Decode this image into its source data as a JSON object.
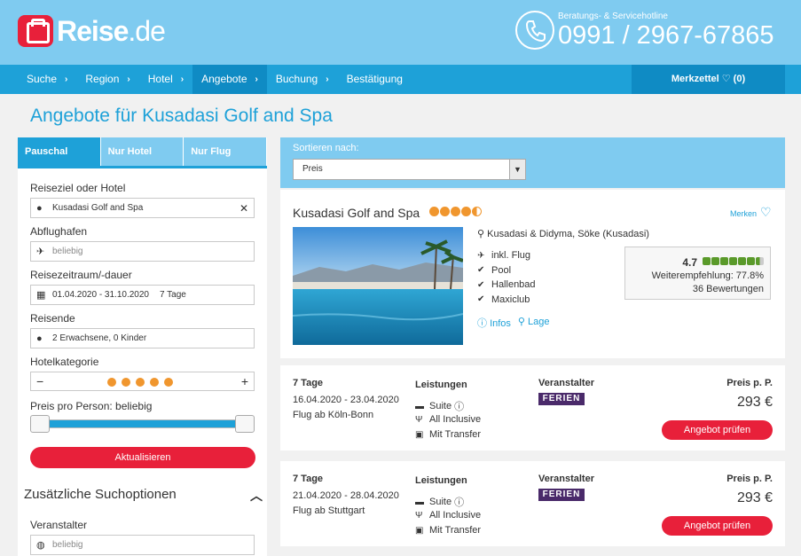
{
  "header": {
    "logo_main": "Reise",
    "logo_tld": ".de",
    "hotline_label": "Beratungs- & Servicehotline",
    "hotline_number": "0991 / 2967-67865"
  },
  "nav": {
    "items": [
      "Suche",
      "Region",
      "Hotel",
      "Angebote",
      "Buchung",
      "Bestätigung"
    ],
    "merkzettel": "Merkzettel ♡ (0)"
  },
  "page_title": "Angebote für Kusadasi Golf and Spa",
  "search": {
    "tabs": [
      "Pauschal",
      "Nur Hotel",
      "Nur Flug"
    ],
    "destination_label": "Reiseziel oder Hotel",
    "destination_value": "Kusadasi Golf and Spa",
    "airport_label": "Abflughafen",
    "airport_placeholder": "beliebig",
    "period_label": "Reisezeitraum/-dauer",
    "period_value": "01.04.2020 - 31.10.2020",
    "period_duration": "7 Tage",
    "travelers_label": "Reisende",
    "travelers_value": "2 Erwachsene, 0 Kinder",
    "category_label": "Hotelkategorie",
    "category_minus": "−",
    "category_plus": "+",
    "category_stars": 5,
    "price_label": "Preis pro Person: beliebig",
    "update_button": "Aktualisieren",
    "extra_title": "Zusätzliche Suchoptionen",
    "operator_label": "Veranstalter",
    "operator_placeholder": "beliebig"
  },
  "sort": {
    "label": "Sortieren nach:",
    "value": "Preis"
  },
  "hotel": {
    "name": "Kusadasi Golf and Spa",
    "stars": 4.5,
    "merken": "Merken",
    "location": "Kusadasi & Didyma, Söke (Kusadasi)",
    "features": [
      "inkl. Flug",
      "Pool",
      "Hallenbad",
      "Maxiclub"
    ],
    "links": [
      "Infos",
      "Lage"
    ],
    "review_score": "4.7",
    "review_recommend": "Weiterempfehlung: 77.8%",
    "review_count": "36 Bewertungen"
  },
  "offers": [
    {
      "duration": "7 Tage",
      "dates": "16.04.2020 - 23.04.2020",
      "flight": "Flug ab Köln-Bonn",
      "services_label": "Leistungen",
      "services": [
        "Suite",
        "All Inclusive",
        "Mit Transfer"
      ],
      "operator_label": "Veranstalter",
      "operator": "FERIEN",
      "price_label": "Preis p. P.",
      "price": "293 €",
      "button": "Angebot prüfen"
    },
    {
      "duration": "7 Tage",
      "dates": "21.04.2020 - 28.04.2020",
      "flight": "Flug ab Stuttgart",
      "services_label": "Leistungen",
      "services": [
        "Suite",
        "All Inclusive",
        "Mit Transfer"
      ],
      "operator_label": "Veranstalter",
      "operator": "FERIEN",
      "price_label": "Preis p. P.",
      "price": "293 €",
      "button": "Angebot prüfen"
    }
  ],
  "colors": {
    "header_bg": "#7fcbf0",
    "nav_bg": "#1ea1d8",
    "accent_red": "#e8203a",
    "star_orange": "#f0962e",
    "link_blue": "#1ea1d8"
  }
}
